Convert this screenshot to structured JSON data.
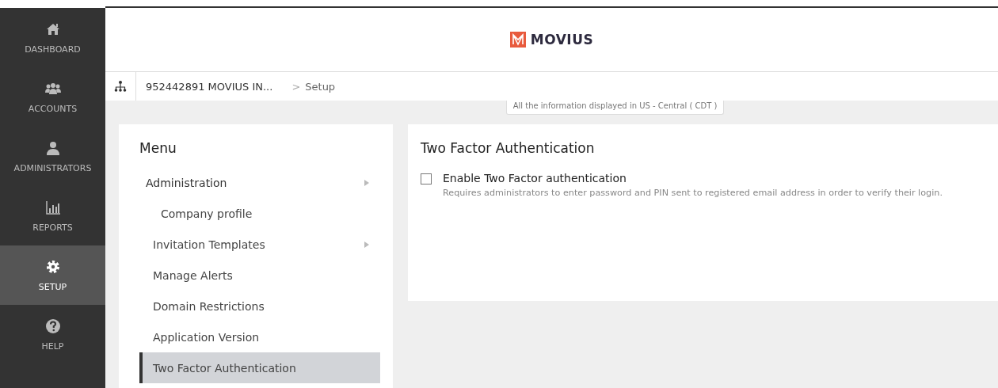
{
  "sidebar": {
    "items": [
      {
        "label": "DASHBOARD",
        "selected": false
      },
      {
        "label": "ACCOUNTS",
        "selected": false
      },
      {
        "label": "ADMINISTRATORS",
        "selected": false
      },
      {
        "label": "REPORTS",
        "selected": false
      },
      {
        "label": "SETUP",
        "selected": true
      },
      {
        "label": "HELP",
        "selected": false
      }
    ]
  },
  "header": {
    "brand": "MOVIUS"
  },
  "breadcrumb": {
    "items": [
      "952442891 MOVIUS IN...",
      "Setup"
    ],
    "separator": ">"
  },
  "timezone_note": "All the information displayed in US - Central ( CDT )",
  "menu": {
    "title": "Menu",
    "items": [
      {
        "label": "Administration",
        "kind": "group",
        "has_submenu": true,
        "selected": false,
        "children": [
          {
            "label": "Company profile",
            "selected": false
          }
        ]
      },
      {
        "label": "Invitation Templates",
        "kind": "item",
        "has_submenu": true,
        "selected": false
      },
      {
        "label": "Manage Alerts",
        "kind": "item",
        "has_submenu": false,
        "selected": false
      },
      {
        "label": "Domain Restrictions",
        "kind": "item",
        "has_submenu": false,
        "selected": false
      },
      {
        "label": "Application Version",
        "kind": "item",
        "has_submenu": false,
        "selected": false
      },
      {
        "label": "Two Factor Authentication",
        "kind": "item",
        "has_submenu": false,
        "selected": true
      }
    ]
  },
  "panel": {
    "title": "Two Factor Authentication",
    "option": {
      "label": "Enable Two Factor authentication",
      "checked": false,
      "description": "Requires administrators to enter password and PIN sent to registered email address in order to verify their login."
    }
  }
}
